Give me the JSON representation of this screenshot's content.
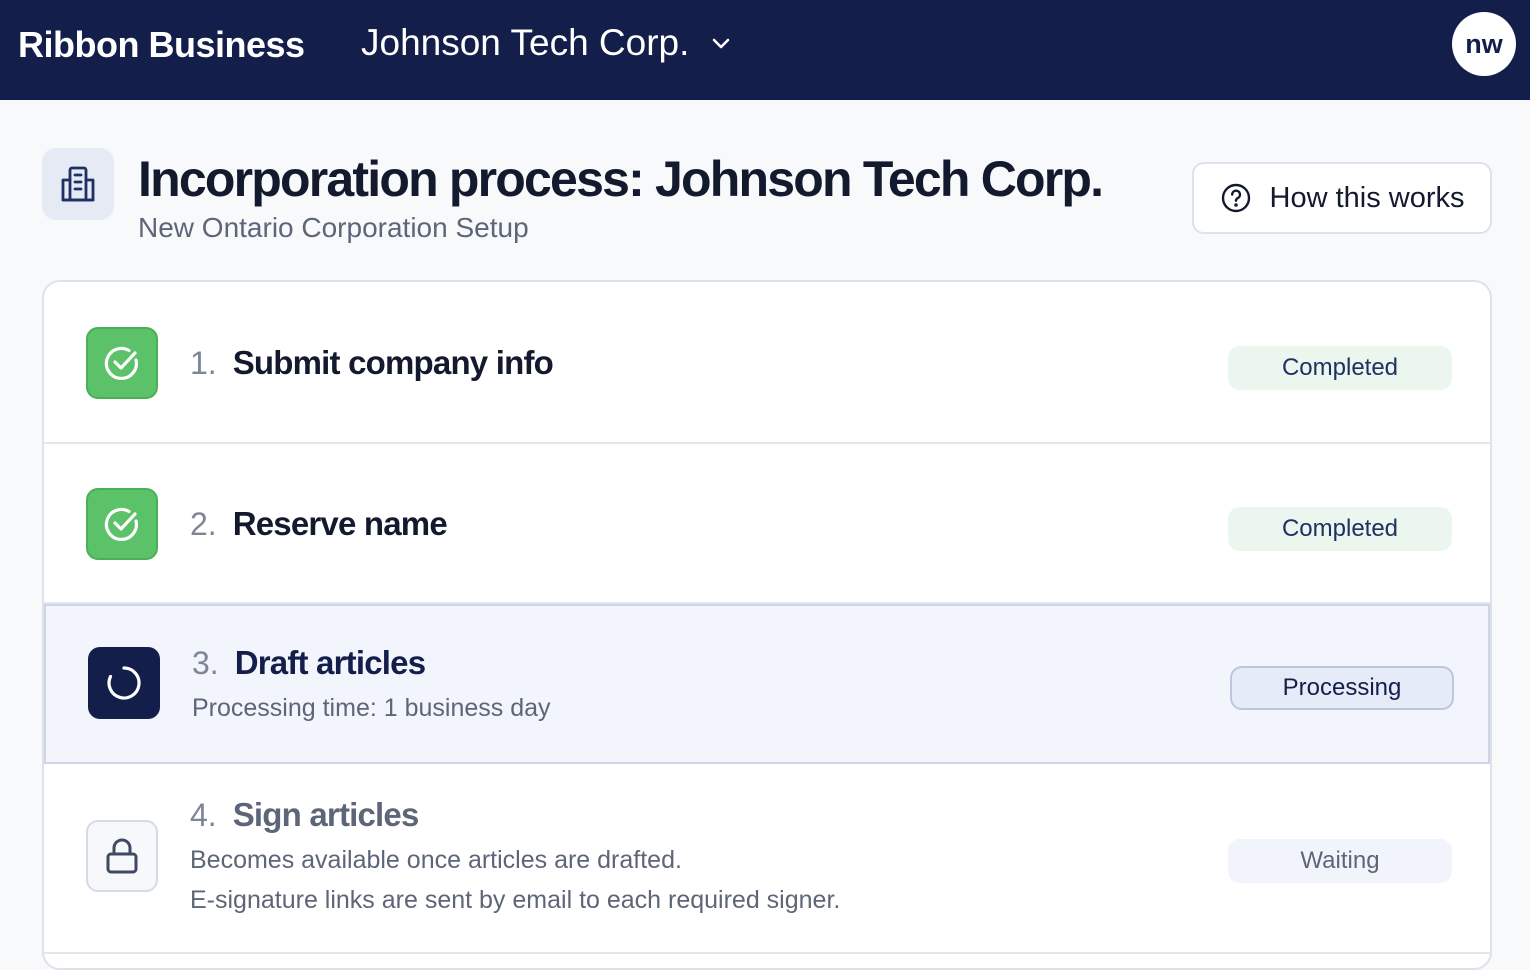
{
  "header": {
    "brand": "Ribbon Business",
    "company": "Johnson Tech Corp.",
    "avatar_initials": "nw"
  },
  "page": {
    "title": "Incorporation process: Johnson Tech Corp.",
    "subtitle": "New Ontario Corporation Setup",
    "help_label": "How this works"
  },
  "steps": [
    {
      "number": "1.",
      "title": "Submit company info",
      "status": "Completed",
      "state": "completed"
    },
    {
      "number": "2.",
      "title": "Reserve name",
      "status": "Completed",
      "state": "completed"
    },
    {
      "number": "3.",
      "title": "Draft articles",
      "description": "Processing time: 1 business day",
      "status": "Processing",
      "state": "processing"
    },
    {
      "number": "4.",
      "title": "Sign articles",
      "description": "Becomes available once articles are drafted.",
      "description2": "E-signature links are sent by email to each required signer.",
      "status": "Waiting",
      "state": "waiting"
    }
  ],
  "icons": {
    "page": "building-icon",
    "help": "question-circle-icon",
    "company_dropdown": "chevron-down-icon",
    "step_done": "check-circle-icon",
    "step_processing": "spinner-icon",
    "step_locked": "lock-icon"
  },
  "colors": {
    "header_bg": "#131e4a",
    "success": "#5cc26a",
    "completed_badge_bg": "#ebf6ef",
    "processing_badge_bg": "#e6ebf8",
    "waiting_badge_bg": "#f1f4fb"
  }
}
